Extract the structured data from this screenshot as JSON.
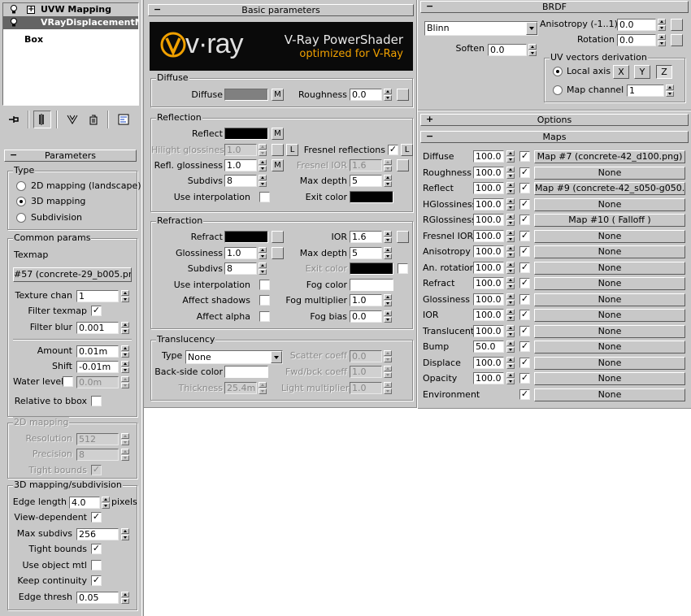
{
  "stack": {
    "item1": "UVW Mapping",
    "item2": "VRayDisplacementMod",
    "item3": "Box"
  },
  "params": {
    "title": "Parameters",
    "type_group": "Type",
    "type_options": [
      "2D mapping (landscape)",
      "3D mapping",
      "Subdivision"
    ],
    "common_group": "Common params",
    "texmap_label": "Texmap",
    "texmap_value": "#57 (concrete-29_b005.png)",
    "texture_chan_label": "Texture chan",
    "texture_chan_value": "1",
    "filter_texmap_label": "Filter texmap",
    "filter_blur_label": "Filter blur",
    "filter_blur_value": "0.001",
    "amount_label": "Amount",
    "amount_value": "0.01m",
    "shift_label": "Shift",
    "shift_value": "-0.01m",
    "water_level_label": "Water level",
    "water_level_value": "0.0m",
    "relative_label": "Relative to bbox",
    "mapping2d_group": "2D mapping",
    "resolution_label": "Resolution",
    "resolution_value": "512",
    "precision_label": "Precision",
    "precision_value": "8",
    "tight_bounds_label": "Tight bounds",
    "mapping3d_group": "3D mapping/subdivision",
    "edge_length_label": "Edge length",
    "edge_length_value": "4.0",
    "pixels_label": "pixels",
    "view_dependent_label": "View-dependent",
    "max_subdivs_label": "Max subdivs",
    "max_subdivs_value": "256",
    "tight_bounds2_label": "Tight bounds",
    "use_object_mtl_label": "Use object mtl",
    "keep_continuity_label": "Keep continuity",
    "edge_thresh_label": "Edge thresh",
    "edge_thresh_value": "0.05"
  },
  "basic": {
    "title": "Basic parameters",
    "banner_logo": "v·ray",
    "banner_title": "V-Ray PowerShader",
    "banner_subtitle": "optimized for V-Ray",
    "diffuse_group": "Diffuse",
    "diffuse_label": "Diffuse",
    "m": "M",
    "roughness_label": "Roughness",
    "roughness_value": "0.0",
    "reflection_group": "Reflection",
    "reflect_label": "Reflect",
    "hilight_label": "Hilight glossiness",
    "hilight_value": "1.0",
    "l": "L",
    "fresnel_label": "Fresnel reflections",
    "refl_gloss_label": "Refl. glossiness",
    "refl_gloss_value": "1.0",
    "fresnel_ior_label": "Fresnel IOR",
    "fresnel_ior_value": "1.6",
    "subdivs_label": "Subdivs",
    "subdivs_value": "8",
    "max_depth_label": "Max depth",
    "max_depth_value": "5",
    "use_interp_label": "Use interpolation",
    "exit_color_label": "Exit color",
    "refraction_group": "Refraction",
    "refract_label": "Refract",
    "ior_label": "IOR",
    "ior_value": "1.6",
    "glossiness_label": "Glossiness",
    "glossiness_value": "1.0",
    "r_subdivs_value": "8",
    "r_max_depth_value": "5",
    "r_exit_color_label": "Exit color",
    "r_use_interp_label": "Use interpolation",
    "fog_color_label": "Fog color",
    "affect_shadows_label": "Affect shadows",
    "fog_mult_label": "Fog multiplier",
    "fog_mult_value": "1.0",
    "affect_alpha_label": "Affect alpha",
    "fog_bias_label": "Fog bias",
    "fog_bias_value": "0.0",
    "translucency_group": "Translucency",
    "type_label": "Type",
    "type_value": "None",
    "scatter_label": "Scatter coeff",
    "scatter_value": "0.0",
    "backside_label": "Back-side color",
    "fwd_label": "Fwd/bck coeff",
    "fwd_value": "1.0",
    "thickness_label": "Thickness",
    "thickness_value": "25.4m",
    "light_mult_label": "Light multiplier",
    "light_mult_value": "1.0"
  },
  "brdf": {
    "title": "BRDF",
    "type_value": "Blinn",
    "anisotropy_label": "Anisotropy (-1..1)",
    "anisotropy_value": "0.0",
    "rotation_label": "Rotation",
    "rotation_value": "0.0",
    "soften_label": "Soften",
    "soften_value": "0.0",
    "uv_group": "UV vectors derivation",
    "local_axis_label": "Local axis",
    "x": "X",
    "y": "Y",
    "z": "Z",
    "map_channel_label": "Map channel",
    "map_channel_value": "1"
  },
  "options": {
    "title": "Options"
  },
  "maps": {
    "title": "Maps",
    "rows": [
      {
        "label": "Diffuse",
        "value": "100.0",
        "map": "Map #7 (concrete-42_d100.png)"
      },
      {
        "label": "Roughness",
        "value": "100.0",
        "map": "None"
      },
      {
        "label": "Reflect",
        "value": "100.0",
        "map": "Map #9 (concrete-42_s050-g050.png)"
      },
      {
        "label": "HGlossiness",
        "value": "100.0",
        "map": "None"
      },
      {
        "label": "RGlossiness",
        "value": "100.0",
        "map": "Map #10 ( Falloff )"
      },
      {
        "label": "Fresnel IOR",
        "value": "100.0",
        "map": "None"
      },
      {
        "label": "Anisotropy",
        "value": "100.0",
        "map": "None"
      },
      {
        "label": "An. rotation",
        "value": "100.0",
        "map": "None"
      },
      {
        "label": "Refract",
        "value": "100.0",
        "map": "None"
      },
      {
        "label": "Glossiness",
        "value": "100.0",
        "map": "None"
      },
      {
        "label": "IOR",
        "value": "100.0",
        "map": "None"
      },
      {
        "label": "Translucent",
        "value": "100.0",
        "map": "None"
      },
      {
        "label": "Bump",
        "value": "50.0",
        "map": "None"
      },
      {
        "label": "Displace",
        "value": "100.0",
        "map": "None"
      },
      {
        "label": "Opacity",
        "value": "100.0",
        "map": "None"
      },
      {
        "label": "Environment",
        "value": "",
        "map": "None"
      }
    ]
  },
  "colors": {
    "panel": "#c8c8c8",
    "selected": "#646464",
    "diffuse_swatch": "#808080",
    "banner_bg": "#0a0a0a",
    "banner_orange": "#f0a000"
  },
  "check": "✓"
}
